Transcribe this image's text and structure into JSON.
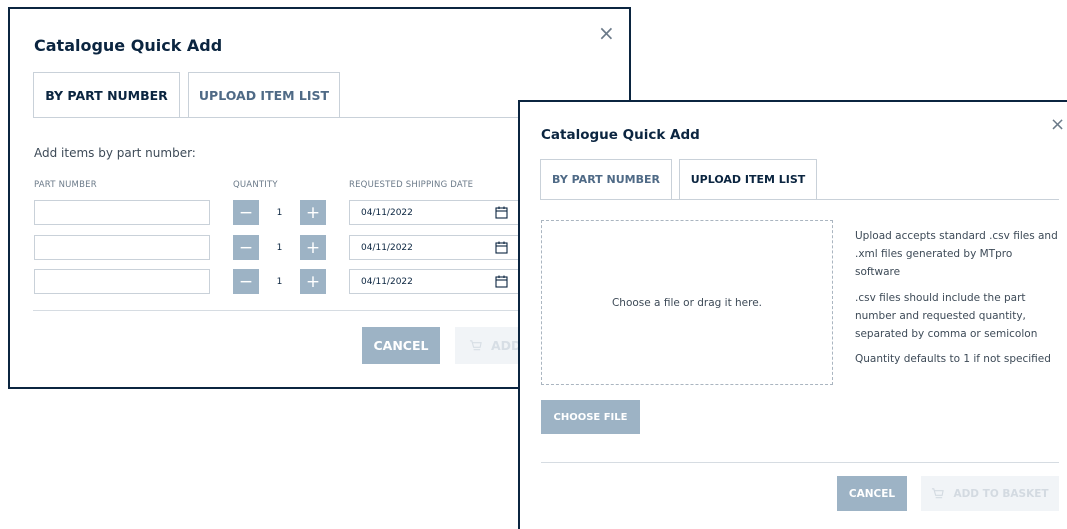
{
  "dialog_by_part": {
    "title": "Catalogue Quick Add",
    "close_glyph": "×",
    "tabs": [
      {
        "label": "BY PART NUMBER",
        "active": true
      },
      {
        "label": "UPLOAD ITEM LIST",
        "active": false
      }
    ],
    "intro": "Add items by part number:",
    "columns": {
      "part_number": "PART NUMBER",
      "quantity": "QUANTITY",
      "shipping_date": "REQUESTED SHIPPING DATE"
    },
    "rows": [
      {
        "part_number": "",
        "quantity": "1",
        "date": "04/11/2022"
      },
      {
        "part_number": "",
        "quantity": "1",
        "date": "04/11/2022"
      },
      {
        "part_number": "",
        "quantity": "1",
        "date": "04/11/2022"
      }
    ],
    "minus_glyph": "−",
    "plus_glyph": "+",
    "cancel_label": "CANCEL",
    "add_label": "ADD"
  },
  "dialog_upload": {
    "title": "Catalogue Quick Add",
    "close_glyph": "×",
    "tabs": [
      {
        "label": "BY PART NUMBER",
        "active": false
      },
      {
        "label": "UPLOAD ITEM LIST",
        "active": true
      }
    ],
    "dropzone_text": "Choose a file or drag it here.",
    "help": [
      "Upload accepts standard .csv files and .xml files generated by MTpro software",
      ".csv files should include the part number and requested quantity, separated by comma or semicolon",
      "Quantity defaults to 1 if not specified"
    ],
    "choose_file_label": "CHOOSE FILE",
    "cancel_label": "CANCEL",
    "add_to_basket_label": "ADD TO BASKET"
  },
  "colors": {
    "brand_navy": "#0b2540",
    "button_blue": "#9db3c5",
    "disabled_bg": "#f1f4f7",
    "border": "#c9d1d9"
  },
  "icons": [
    "close-icon",
    "calendar-icon",
    "minus-icon",
    "plus-icon",
    "cart-icon"
  ]
}
